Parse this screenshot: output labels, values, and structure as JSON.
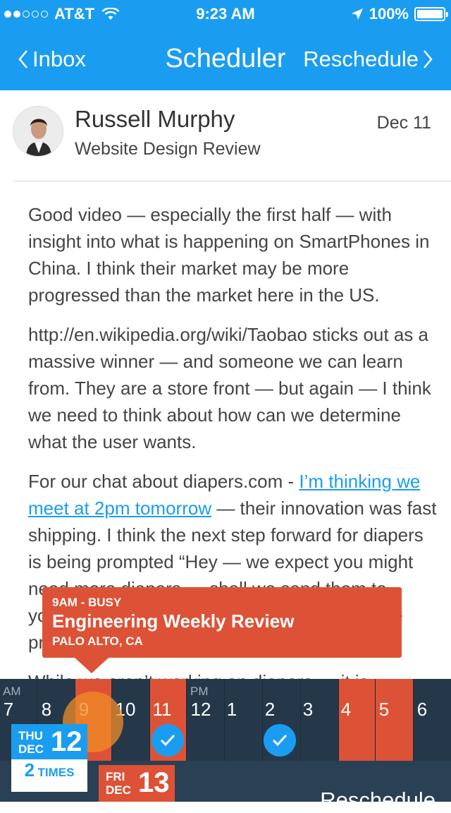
{
  "status_bar": {
    "carrier": "AT&T",
    "time": "9:23 AM",
    "battery": "100%"
  },
  "nav": {
    "back_label": "Inbox",
    "title": "Scheduler",
    "action_label": "Reschedule"
  },
  "email": {
    "sender": "Russell Murphy",
    "subject": "Website Design Review",
    "date": "Dec 11",
    "paragraphs": [
      "Good video — especially the first half — with insight into what is happening on SmartPhones in China. I think their market may be more progressed than the market here in the US.",
      "http://en.wikipedia.org/wiki/Taobao sticks out as a massive winner — and someone we can learn from. They are a store front — but again — I think we need to think about how can we determine what the user wants."
    ],
    "p3_before": "For our chat about diapers.com - ",
    "p3_link": "I’m thinking we meet at 2pm tomorrow",
    "p3_after": " — their innovation was fast shipping. I think the next step forward for diapers is being prompted “Hey — we expect you might need more diapers — shall we send them to you?” or something like that to be built into the process.",
    "p4": "While we aren’t working on diapers — it is"
  },
  "event_tooltip": {
    "time": "9AM - BUSY",
    "title": "Engineering Weekly Review",
    "location": "PALO ALTO, CA"
  },
  "timeline": {
    "am_label": "AM",
    "pm_label": "PM",
    "hours": [
      "7",
      "8",
      "9",
      "10",
      "11",
      "12",
      "1",
      "2",
      "3",
      "4",
      "5",
      "6"
    ]
  },
  "day_selected": {
    "dow": "THU",
    "month": "DEC",
    "day": "12"
  },
  "times_count": {
    "count": "2",
    "label": "TIMES"
  },
  "day_next": {
    "dow": "FRI",
    "month": "DEC",
    "day": "13"
  },
  "bottom_action": "Reschedule",
  "colors": {
    "accent": "#1a9df0",
    "busy": "#dd5236",
    "timeline_bg": "#25384a"
  }
}
